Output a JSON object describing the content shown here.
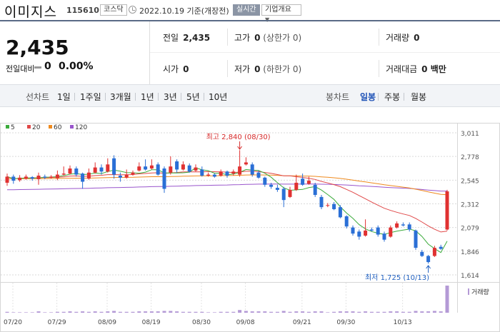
{
  "header": {
    "name": "이미지스",
    "code": "115610",
    "market": "코스닥",
    "date_text": "2022.10.19 기준(개장전)",
    "live_label": "실시간",
    "info_label": "기업개요"
  },
  "summary": {
    "price": "2,435",
    "change_label": "전일대비",
    "change_value": "0",
    "change_pct": "0.00%",
    "prev_label": "전일",
    "prev_value": "2,435",
    "high_label": "고가",
    "high_value": "0",
    "high_sub": "(상한가 0)",
    "volume_label": "거래량",
    "volume_value": "0",
    "open_label": "시가",
    "open_value": "0",
    "low_label": "저가",
    "low_value": "0",
    "low_sub": "(하한가 0)",
    "amount_label": "거래대금",
    "amount_value": "0 백만"
  },
  "tabs": {
    "line_label": "선차트",
    "line_tabs": [
      "1일",
      "1주일",
      "3개월",
      "1년",
      "3년",
      "5년",
      "10년"
    ],
    "candle_label": "봉차트",
    "candle_tabs": [
      "일봉",
      "주봉",
      "월봉"
    ],
    "active_candle": 0
  },
  "colors": {
    "up": "#e03131",
    "down": "#2a6fd6",
    "ma5": "#3cab3c",
    "ma20": "#e04848",
    "ma60": "#ef8a1e",
    "ma120": "#9955cc",
    "volume": "#b49ad6"
  },
  "chart_data": {
    "type": "candlestick",
    "legend": [
      {
        "name": "5",
        "color": "#3cab3c"
      },
      {
        "name": "20",
        "color": "#e04848"
      },
      {
        "name": "60",
        "color": "#ef8a1e"
      },
      {
        "name": "120",
        "color": "#9955cc"
      }
    ],
    "y_ticks": [
      "3,011",
      "2,778",
      "2,545",
      "2,312",
      "2,079",
      "1,846",
      "1,614"
    ],
    "ylim": [
      1614,
      3011
    ],
    "x_ticks": [
      "07/20",
      "07/29",
      "08/09",
      "08/19",
      "08/30",
      "09/08",
      "09/21",
      "09/30",
      "10/13"
    ],
    "volume_label": "거래량",
    "annotations": {
      "high": "최고 2,840 (08/30)",
      "low": "최저 1,725 (10/13)"
    },
    "candles": [
      {
        "o": 2520,
        "c": 2580,
        "h": 2610,
        "l": 2490
      },
      {
        "o": 2580,
        "c": 2540,
        "h": 2600,
        "l": 2510
      },
      {
        "o": 2545,
        "c": 2570,
        "h": 2595,
        "l": 2530
      },
      {
        "o": 2560,
        "c": 2580,
        "h": 2600,
        "l": 2550
      },
      {
        "o": 2575,
        "c": 2560,
        "h": 2585,
        "l": 2540
      },
      {
        "o": 2555,
        "c": 2590,
        "h": 2620,
        "l": 2500
      },
      {
        "o": 2580,
        "c": 2570,
        "h": 2600,
        "l": 2555
      },
      {
        "o": 2570,
        "c": 2580,
        "h": 2595,
        "l": 2560
      },
      {
        "o": 2565,
        "c": 2600,
        "h": 2640,
        "l": 2545
      },
      {
        "o": 2600,
        "c": 2610,
        "h": 2680,
        "l": 2590
      },
      {
        "o": 2610,
        "c": 2660,
        "h": 2690,
        "l": 2600
      },
      {
        "o": 2660,
        "c": 2600,
        "h": 2680,
        "l": 2580
      },
      {
        "o": 2610,
        "c": 2530,
        "h": 2620,
        "l": 2460
      },
      {
        "o": 2560,
        "c": 2620,
        "h": 2660,
        "l": 2550
      },
      {
        "o": 2620,
        "c": 2670,
        "h": 2720,
        "l": 2610
      },
      {
        "o": 2670,
        "c": 2630,
        "h": 2700,
        "l": 2600
      },
      {
        "o": 2630,
        "c": 2700,
        "h": 2760,
        "l": 2620
      },
      {
        "o": 2760,
        "c": 2600,
        "h": 2790,
        "l": 2560
      },
      {
        "o": 2590,
        "c": 2570,
        "h": 2620,
        "l": 2530
      },
      {
        "o": 2570,
        "c": 2600,
        "h": 2650,
        "l": 2560
      },
      {
        "o": 2600,
        "c": 2620,
        "h": 2640,
        "l": 2590
      },
      {
        "o": 2640,
        "c": 2680,
        "h": 2720,
        "l": 2630
      },
      {
        "o": 2680,
        "c": 2650,
        "h": 2750,
        "l": 2640
      },
      {
        "o": 2660,
        "c": 2690,
        "h": 2750,
        "l": 2650
      },
      {
        "o": 2700,
        "c": 2600,
        "h": 2720,
        "l": 2590
      },
      {
        "o": 2660,
        "c": 2460,
        "h": 2680,
        "l": 2420
      },
      {
        "o": 2620,
        "c": 2680,
        "h": 2780,
        "l": 2600
      },
      {
        "o": 2730,
        "c": 2650,
        "h": 2750,
        "l": 2620
      },
      {
        "o": 2650,
        "c": 2700,
        "h": 2730,
        "l": 2640
      },
      {
        "o": 2690,
        "c": 2630,
        "h": 2710,
        "l": 2620
      },
      {
        "o": 2640,
        "c": 2670,
        "h": 2700,
        "l": 2630
      },
      {
        "o": 2650,
        "c": 2590,
        "h": 2680,
        "l": 2580
      },
      {
        "o": 2590,
        "c": 2600,
        "h": 2620,
        "l": 2580
      },
      {
        "o": 2600,
        "c": 2580,
        "h": 2610,
        "l": 2570
      },
      {
        "o": 2590,
        "c": 2630,
        "h": 2650,
        "l": 2580
      },
      {
        "o": 2630,
        "c": 2590,
        "h": 2640,
        "l": 2570
      },
      {
        "o": 2610,
        "c": 2630,
        "h": 2650,
        "l": 2590
      },
      {
        "o": 2600,
        "c": 2680,
        "h": 2840,
        "l": 2580
      },
      {
        "o": 2700,
        "c": 2720,
        "h": 2770,
        "l": 2690
      },
      {
        "o": 2700,
        "c": 2600,
        "h": 2720,
        "l": 2580
      },
      {
        "o": 2620,
        "c": 2570,
        "h": 2640,
        "l": 2560
      },
      {
        "o": 2570,
        "c": 2500,
        "h": 2580,
        "l": 2480
      },
      {
        "o": 2500,
        "c": 2480,
        "h": 2520,
        "l": 2460
      },
      {
        "o": 2470,
        "c": 2450,
        "h": 2500,
        "l": 2430
      },
      {
        "o": 2460,
        "c": 2350,
        "h": 2480,
        "l": 2280
      },
      {
        "o": 2380,
        "c": 2450,
        "h": 2480,
        "l": 2370
      },
      {
        "o": 2450,
        "c": 2520,
        "h": 2600,
        "l": 2440
      },
      {
        "o": 2560,
        "c": 2500,
        "h": 2610,
        "l": 2490
      },
      {
        "o": 2510,
        "c": 2540,
        "h": 2580,
        "l": 2500
      },
      {
        "o": 2500,
        "c": 2400,
        "h": 2520,
        "l": 2380
      },
      {
        "o": 2380,
        "c": 2280,
        "h": 2400,
        "l": 2260
      },
      {
        "o": 2300,
        "c": 2300,
        "h": 2320,
        "l": 2280
      },
      {
        "o": 2310,
        "c": 2260,
        "h": 2330,
        "l": 2250
      },
      {
        "o": 2280,
        "c": 2180,
        "h": 2300,
        "l": 2170
      },
      {
        "o": 2190,
        "c": 2090,
        "h": 2200,
        "l": 2070
      },
      {
        "o": 2080,
        "c": 2020,
        "h": 2100,
        "l": 2000
      },
      {
        "o": 2040,
        "c": 1990,
        "h": 2060,
        "l": 1960
      },
      {
        "o": 2000,
        "c": 2050,
        "h": 2160,
        "l": 1990
      },
      {
        "o": 2060,
        "c": 2050,
        "h": 2080,
        "l": 2040
      },
      {
        "o": 2080,
        "c": 2010,
        "h": 2100,
        "l": 1990
      },
      {
        "o": 2020,
        "c": 1960,
        "h": 2040,
        "l": 1940
      },
      {
        "o": 1990,
        "c": 2080,
        "h": 2100,
        "l": 1980
      },
      {
        "o": 2080,
        "c": 2120,
        "h": 2140,
        "l": 2070
      },
      {
        "o": 2110,
        "c": 2100,
        "h": 2130,
        "l": 2090
      },
      {
        "o": 2110,
        "c": 2060,
        "h": 2130,
        "l": 2040
      },
      {
        "o": 2050,
        "c": 1880,
        "h": 2060,
        "l": 1860
      },
      {
        "o": 1840,
        "c": 1800,
        "h": 1860,
        "l": 1790
      },
      {
        "o": 1800,
        "c": 1740,
        "h": 1810,
        "l": 1725
      },
      {
        "o": 1800,
        "c": 1880,
        "h": 1900,
        "l": 1790
      },
      {
        "o": 1890,
        "c": 1870,
        "h": 1910,
        "l": 1860
      },
      {
        "o": 2060,
        "c": 2435,
        "h": 2450,
        "l": 2050
      }
    ],
    "ma_note": "",
    "volumes": [
      2,
      1,
      1,
      1,
      1,
      3,
      1,
      1,
      2,
      2,
      3,
      2,
      3,
      2,
      3,
      2,
      3,
      4,
      2,
      2,
      2,
      3,
      3,
      3,
      3,
      4,
      4,
      3,
      2,
      2,
      2,
      2,
      1,
      1,
      2,
      2,
      2,
      6,
      4,
      3,
      3,
      3,
      2,
      2,
      4,
      2,
      3,
      3,
      2,
      3,
      3,
      1,
      2,
      3,
      3,
      3,
      2,
      3,
      2,
      2,
      2,
      3,
      3,
      2,
      2,
      4,
      3,
      3,
      4,
      3,
      60
    ]
  }
}
